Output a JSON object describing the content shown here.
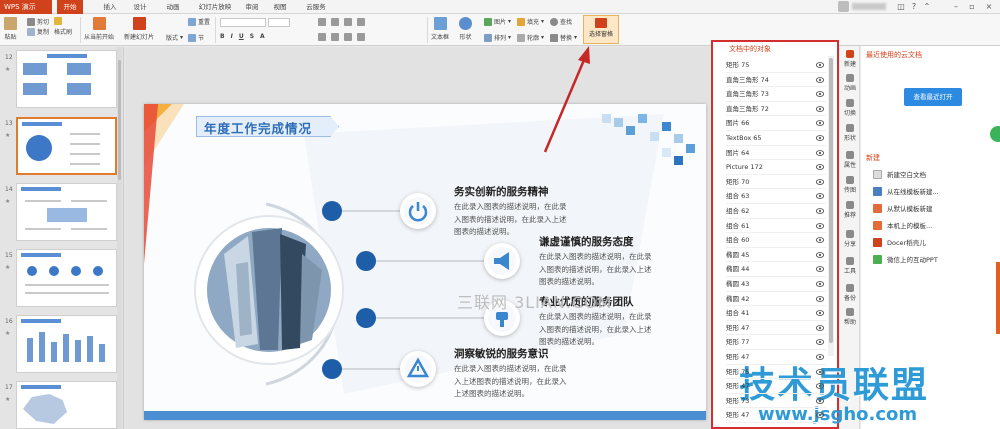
{
  "app": {
    "badge": "WPS 演示"
  },
  "menu_tabs": [
    "开始",
    "插入",
    "设计",
    "动画",
    "幻灯片放映",
    "审阅",
    "视图",
    "云服务"
  ],
  "ribbon": {
    "paste": "粘贴",
    "cut": "剪切",
    "copy": "复制",
    "format_painter": "格式刷",
    "from_current": "从当前开始",
    "new_slide": "新建幻灯片",
    "layout": "版式",
    "section": "节",
    "reset": "重置",
    "textbox": "文本框",
    "shape": "形状",
    "picture": "图片",
    "fill": "填充",
    "arrange": "排列",
    "outline": "轮廓",
    "find": "查找",
    "replace": "替换",
    "selection_pane": "选择窗格"
  },
  "slides": {
    "numbers": [
      "12",
      "13",
      "14",
      "15",
      "16",
      "17"
    ],
    "star": "★"
  },
  "slide": {
    "title": "年度工作完成情况",
    "items": [
      {
        "title": "务实创新的服务精神",
        "desc": "在此录入图表的描述说明，在此录入图表的描述说明，在此录入上述图表的描述说明。"
      },
      {
        "title": "谦虚谨慎的服务态度",
        "desc": "在此录入图表的描述说明，在此录入图表的描述说明，在此录入上述图表的描述说明。"
      },
      {
        "title": "专业优质的服务团队",
        "desc": "在此录入图表的描述说明，在此录入图表的描述说明，在此录入上述图表的描述说明。"
      },
      {
        "title": "洞察敏锐的服务意识",
        "desc": "在此录入图表的描述说明，在此录入上述图表的描述说明，在此录入上述图表的描述说明。"
      }
    ],
    "watermark": "三联网 3LIAN.COM"
  },
  "selection_pane": {
    "header": "文档中的对象",
    "objects": [
      "矩形 75",
      "直角三角形 74",
      "直角三角形 73",
      "直角三角形 72",
      "图片 66",
      "TextBox 65",
      "图片 64",
      "Picture 172",
      "矩形 70",
      "组合 63",
      "组合 62",
      "组合 61",
      "组合 60",
      "椭圆 45",
      "椭圆 44",
      "椭圆 43",
      "椭圆 42",
      "组合 41",
      "矩形 47",
      "矩形 77",
      "矩形 47",
      "矩形 75",
      "矩形 47",
      "矩形 73",
      "矩形 47"
    ]
  },
  "vtabs": [
    "新建",
    "动画",
    "切换",
    "形状",
    "属性",
    "传图",
    "推荐",
    "分享",
    "工具",
    "备份",
    "帮助"
  ],
  "task_pane": {
    "recent_heading": "最近使用的云文档",
    "open_recent": "查看最近打开",
    "new_heading": "新建",
    "new_items": [
      "新建空白文档",
      "从在线模板新建...",
      "从默认模板新建",
      "本机上的模板...",
      "Docer稻壳儿",
      "微信上的互动PPT"
    ]
  },
  "brand": {
    "title": "技术员联盟",
    "url": "www.jsgho.com"
  },
  "colors": {
    "accent": "#d0421b",
    "slide_blue": "#2d6db7",
    "dot_blue": "#1e5ea8",
    "highlight_red": "#d32f2f",
    "brand_blue": "#2f9bd6"
  }
}
